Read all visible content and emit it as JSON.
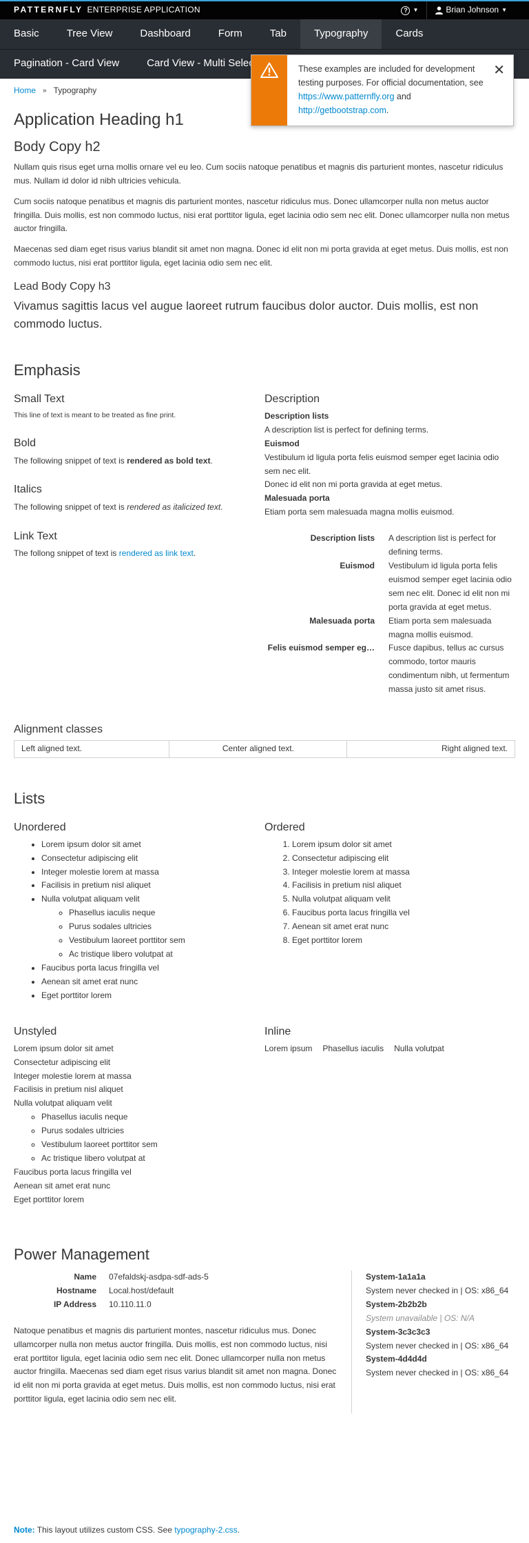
{
  "topbar": {
    "brand_bold": "PATTERNFLY",
    "brand_rest": "ENTERPRISE APPLICATION",
    "help_glyph": "?",
    "user_name": "Brian Johnson"
  },
  "nav": {
    "row1": [
      "Basic",
      "Tree View",
      "Dashboard",
      "Form",
      "Tab",
      "Typography",
      "Cards"
    ],
    "row2": [
      "Pagination - Card View",
      "Card View - Multi Select"
    ],
    "active": "Typography"
  },
  "breadcrumb": {
    "home": "Home",
    "sep": "»",
    "current": "Typography"
  },
  "toast": {
    "text1": "These examples are included for development testing purposes. For official documentation, see",
    "link1": "https://www.patternfly.org",
    "and": "and",
    "link2": "http://getbootstrap.com",
    "end": ".",
    "close": "✕",
    "colors": {
      "warning": "#ec7a08"
    }
  },
  "headings": {
    "h1": "Application Heading h1",
    "h2": "Body Copy h2",
    "p1": "Nullam quis risus eget urna mollis ornare vel eu leo. Cum sociis natoque penatibus et magnis dis parturient montes, nascetur ridiculus mus. Nullam id dolor id nibh ultricies vehicula.",
    "p2": "Cum sociis natoque penatibus et magnis dis parturient montes, nascetur ridiculus mus. Donec ullamcorper nulla non metus auctor fringilla. Duis mollis, est non commodo luctus, nisi erat porttitor ligula, eget lacinia odio sem nec elit. Donec ullamcorper nulla non metus auctor fringilla.",
    "p3": "Maecenas sed diam eget risus varius blandit sit amet non magna. Donec id elit non mi porta gravida at eget metus. Duis mollis, est non commodo luctus, nisi erat porttitor ligula, eget lacinia odio sem nec elit.",
    "h3": "Lead Body Copy h3",
    "lead": "Vivamus sagittis lacus vel augue laoreet rutrum faucibus dolor auctor. Duis mollis, est non commodo luctus."
  },
  "emphasis": {
    "title": "Emphasis",
    "small_title": "Small Text",
    "small_text": "This line of text is meant to be treated as fine print.",
    "bold_title": "Bold",
    "bold_pre": "The following snippet of text is ",
    "bold_strong": "rendered as bold text",
    "bold_post": ".",
    "italics_title": "Italics",
    "italics_pre": "The following snippet of text is ",
    "italics_em": "rendered as italicized text",
    "italics_post": ".",
    "link_title": "Link Text",
    "link_pre": "The follong snippet of text is ",
    "link_a": "rendered as link text",
    "link_post": ".",
    "desc_title": "Description",
    "dl": [
      {
        "dt": "Description lists",
        "dd": [
          "A description list is perfect for defining terms."
        ]
      },
      {
        "dt": "Euismod",
        "dd": [
          "Vestibulum id ligula porta felis euismod semper eget lacinia odio sem nec elit.",
          "Donec id elit non mi porta gravida at eget metus."
        ]
      },
      {
        "dt": "Malesuada porta",
        "dd": [
          "Etiam porta sem malesuada magna mollis euismod."
        ]
      }
    ],
    "dlh": [
      {
        "dt": "Description lists",
        "dd": "A description list is perfect for defining terms."
      },
      {
        "dt": "Euismod",
        "dd": "Vestibulum id ligula porta felis euismod semper eget lacinia odio sem nec elit. Donec id elit non mi porta gravida at eget metus."
      },
      {
        "dt": "Malesuada porta",
        "dd": "Etiam porta sem malesuada magna mollis euismod."
      },
      {
        "dt": "Felis euismod semper eg…",
        "dd": "Fusce dapibus, tellus ac cursus commodo, tortor mauris condimentum nibh, ut fermentum massa justo sit amet risus."
      }
    ]
  },
  "alignment": {
    "title": "Alignment classes",
    "left": "Left aligned text.",
    "center": "Center aligned text.",
    "right": "Right aligned text."
  },
  "lists": {
    "title": "Lists",
    "unordered_title": "Unordered",
    "ordered_title": "Ordered",
    "unstyled_title": "Unstyled",
    "inline_title": "Inline",
    "items_before": [
      "Lorem ipsum dolor sit amet",
      "Consectetur adipiscing elit",
      "Integer molestie lorem at massa",
      "Facilisis in pretium nisl aliquet",
      "Nulla volutpat aliquam velit"
    ],
    "nested": [
      "Phasellus iaculis neque",
      "Purus sodales ultricies",
      "Vestibulum laoreet porttitor sem",
      "Ac tristique libero volutpat at"
    ],
    "items_after": [
      "Faucibus porta lacus fringilla vel",
      "Aenean sit amet erat nunc",
      "Eget porttitor lorem"
    ],
    "ordered": [
      "Lorem ipsum dolor sit amet",
      "Consectetur adipiscing elit",
      "Integer molestie lorem at massa",
      "Facilisis in pretium nisl aliquet",
      "Nulla volutpat aliquam velit",
      "Faucibus porta lacus fringilla vel",
      "Aenean sit amet erat nunc",
      "Eget porttitor lorem"
    ],
    "inline": [
      "Lorem ipsum",
      "Phasellus iaculis",
      "Nulla volutpat"
    ]
  },
  "power": {
    "title": "Power Management",
    "kv": [
      {
        "k": "Name",
        "v": "07efaldskj-asdpa-sdf-ads-5"
      },
      {
        "k": "Hostname",
        "v": "Local.host/default"
      },
      {
        "k": "IP Address",
        "v": "10.110.11.0"
      }
    ],
    "paragraph": "Natoque penatibus et magnis dis parturient montes, nascetur ridiculus mus. Donec ullamcorper nulla non metus auctor fringilla. Duis mollis, est non commodo luctus, nisi erat porttitor ligula, eget lacinia odio sem nec elit. Donec ullamcorper nulla non metus auctor fringilla. Maecenas sed diam eget risus varius blandit sit amet non magna. Donec id elit non mi porta gravida at eget metus. Duis mollis, est non commodo luctus, nisi erat porttitor ligula, eget lacinia odio sem nec elit.",
    "systems": [
      {
        "name": "System-1a1a1a",
        "status": "System never checked in | OS: x86_64",
        "muted": false
      },
      {
        "name": "System-2b2b2b",
        "status": "System unavailable | OS: N/A",
        "muted": true
      },
      {
        "name": "System-3c3c3c3",
        "status": "System never checked in | OS: x86_64",
        "muted": false
      },
      {
        "name": "System-4d4d4d",
        "status": "System never checked in | OS: x86_64",
        "muted": false
      }
    ]
  },
  "note": {
    "label": "Note:",
    "text": " This layout utilizes custom CSS. See ",
    "link": "typography-2.css",
    "end": "."
  }
}
